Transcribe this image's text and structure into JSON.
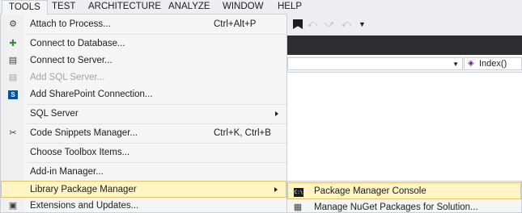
{
  "menubar": {
    "items": [
      {
        "label": "TOOLS",
        "active": true
      },
      {
        "label": "TEST"
      },
      {
        "label": "ARCHITECTURE"
      },
      {
        "label": "ANALYZE"
      },
      {
        "label": "WINDOW"
      },
      {
        "label": "HELP"
      }
    ]
  },
  "navigation_bar": {
    "member_label": "Index()"
  },
  "tools_menu": {
    "items": [
      {
        "label": "Attach to Process...",
        "shortcut": "Ctrl+Alt+P",
        "icon": "attach-process-icon"
      },
      {
        "label": "Connect to Database...",
        "icon": "connect-database-icon"
      },
      {
        "label": "Connect to Server...",
        "icon": "connect-server-icon"
      },
      {
        "label": "Add SQL Server...",
        "icon": "add-sql-server-icon",
        "disabled": true
      },
      {
        "label": "Add SharePoint Connection...",
        "icon": "sharepoint-icon"
      },
      {
        "label": "SQL Server",
        "submenu": true
      },
      {
        "label": "Code Snippets Manager...",
        "shortcut": "Ctrl+K, Ctrl+B",
        "icon": "code-snippets-icon"
      },
      {
        "label": "Choose Toolbox Items..."
      },
      {
        "label": "Add-in Manager..."
      },
      {
        "label": "Library Package Manager",
        "submenu": true,
        "highlighted": true
      },
      {
        "label": "Extensions and Updates...",
        "icon": "extensions-icon"
      }
    ]
  },
  "package_manager_submenu": {
    "items": [
      {
        "label": "Package Manager Console",
        "icon": "console-icon",
        "highlighted": true
      },
      {
        "label": "Manage NuGet Packages for Solution...",
        "icon": "nuget-packages-icon"
      }
    ]
  },
  "colors": {
    "menu_background": "#f5f5f5",
    "highlight_background": "#fff4c4",
    "highlight_border": "#e5c365",
    "menubar_background": "#eeeef2",
    "tab_strip": "#2d2d30",
    "disabled_text": "#a2a4a5"
  }
}
